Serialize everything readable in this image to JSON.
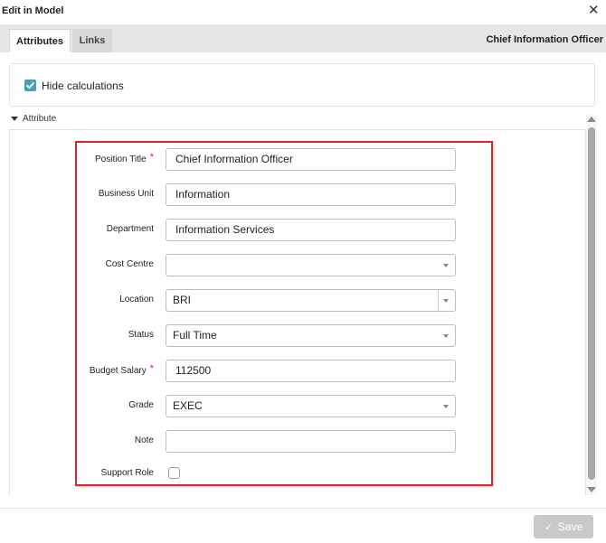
{
  "dialog": {
    "title": "Edit in Model",
    "close_icon": "close-icon"
  },
  "tabs": [
    {
      "label": "Attributes",
      "active": true
    },
    {
      "label": "Links",
      "active": false
    }
  ],
  "record_title": "Chief Information Officer",
  "hide_calculations": {
    "label": "Hide calculations",
    "checked": true
  },
  "section": {
    "label": "Attribute",
    "expanded": true
  },
  "form": {
    "position_title": {
      "label": "Position Title",
      "value": "Chief Information Officer",
      "required": true
    },
    "business_unit": {
      "label": "Business Unit",
      "value": "Information"
    },
    "department": {
      "label": "Department",
      "value": "Information Services"
    },
    "cost_centre": {
      "label": "Cost Centre",
      "value": ""
    },
    "location": {
      "label": "Location",
      "value": "BRI"
    },
    "status": {
      "label": "Status",
      "value": "Full Time"
    },
    "budget_salary": {
      "label": "Budget Salary",
      "value": "112500",
      "required": true
    },
    "grade": {
      "label": "Grade",
      "value": "EXEC"
    },
    "note": {
      "label": "Note",
      "value": ""
    },
    "support_role": {
      "label": "Support Role",
      "checked": false
    }
  },
  "required_marker": "*",
  "footer": {
    "save_label": "Save",
    "save_enabled": false
  },
  "colors": {
    "accent": "#4a9dbd",
    "highlight": "#d9262b",
    "required": "#d9262b",
    "disabled_button": "#c9c9c9"
  }
}
